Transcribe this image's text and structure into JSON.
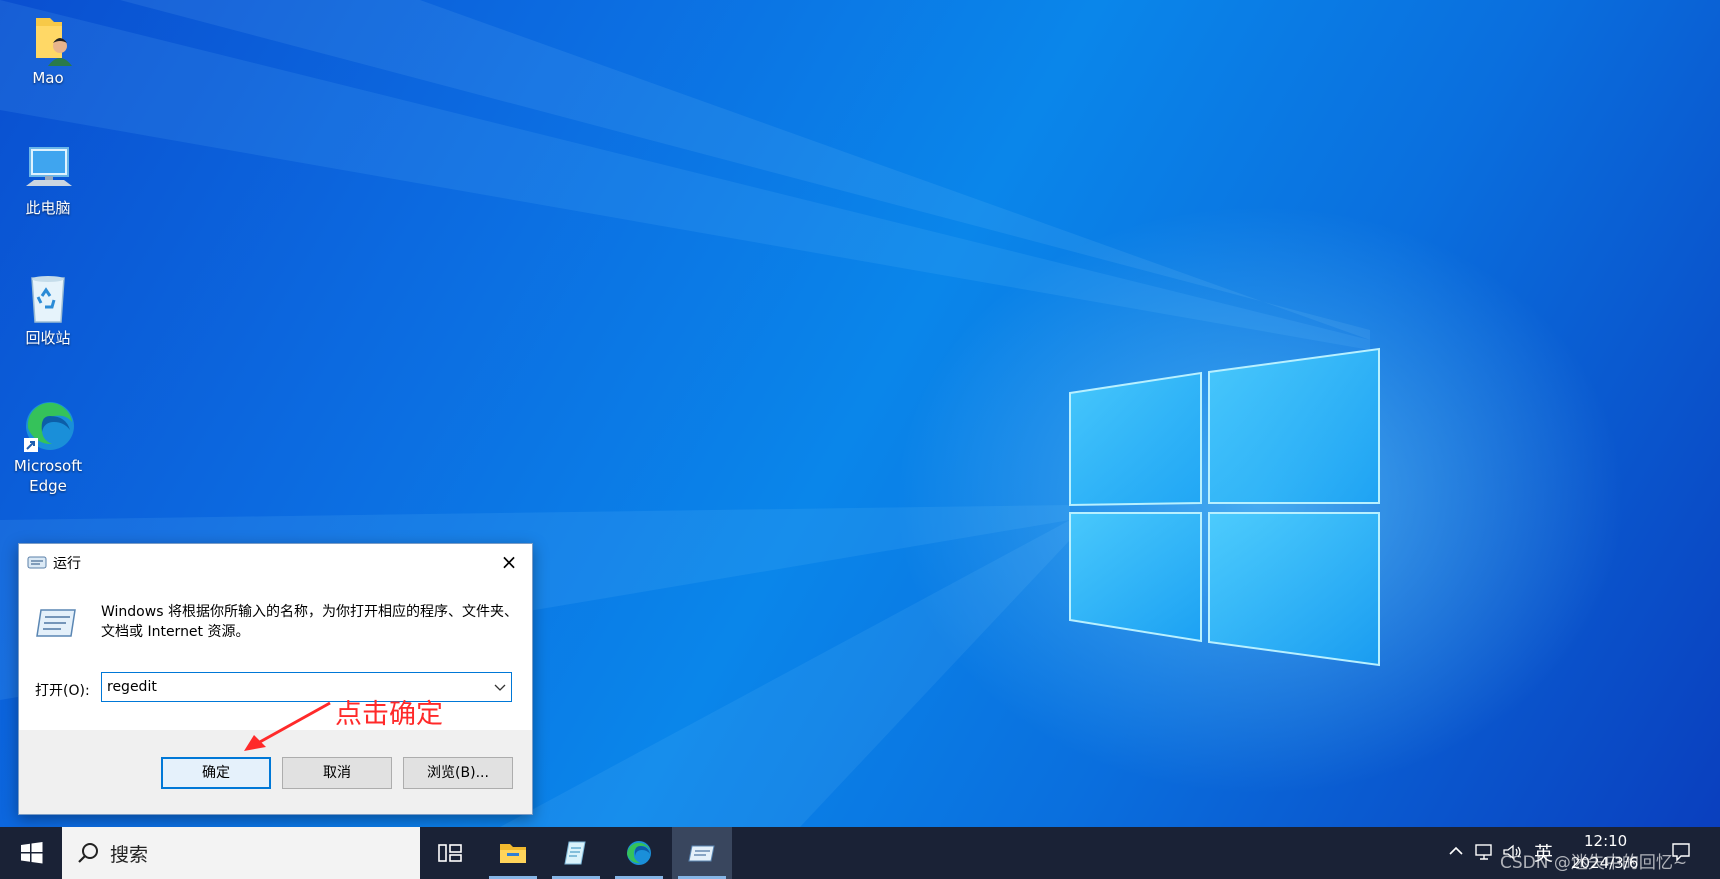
{
  "desktop": {
    "icons": [
      {
        "label": "Mao",
        "icon": "user-folder-icon"
      },
      {
        "label": "此电脑",
        "icon": "computer-icon"
      },
      {
        "label": "回收站",
        "icon": "recycle-bin-icon"
      },
      {
        "label": "Microsoft Edge",
        "icon": "edge-icon"
      }
    ]
  },
  "run_dialog": {
    "title": "运行",
    "close_icon": "×",
    "description": "Windows 将根据你所输入的名称，为你打开相应的程序、文件夹、文档或 Internet 资源。",
    "open_label": "打开(O):",
    "open_value": "regedit",
    "buttons": {
      "ok": "确定",
      "cancel": "取消",
      "browse": "浏览(B)..."
    }
  },
  "annotation": {
    "text": "点击确定",
    "color": "#ff2a2a"
  },
  "taskbar": {
    "search_placeholder": "搜索",
    "apps": [
      "task-view-icon",
      "file-explorer-icon",
      "notepad-icon",
      "edge-icon",
      "run-icon"
    ],
    "tray": {
      "ime": "英",
      "time": "12:10",
      "date": "2024/3/6"
    }
  },
  "watermark": "CSDN @迷失中的回忆~",
  "colors": {
    "taskbar_bg": "#1a2236",
    "accent": "#0078d7"
  }
}
